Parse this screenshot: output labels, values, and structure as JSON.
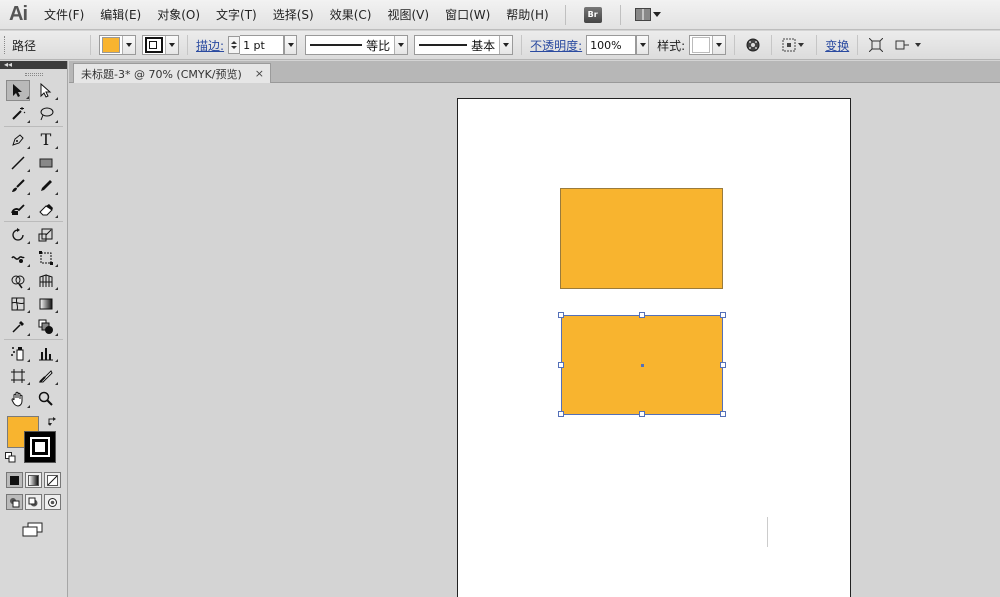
{
  "app": {
    "logo": "Ai"
  },
  "menu": {
    "items": [
      "文件(F)",
      "编辑(E)",
      "对象(O)",
      "文字(T)",
      "选择(S)",
      "效果(C)",
      "视图(V)",
      "窗口(W)",
      "帮助(H)"
    ],
    "bridge_label": "Br"
  },
  "control": {
    "selection_type": "路径",
    "stroke_label": "描边:",
    "stroke_weight": "1 pt",
    "profile_label": "等比",
    "brush_label": "基本",
    "opacity_label": "不透明度:",
    "opacity_value": "100%",
    "style_label": "样式:",
    "transform_label": "变换"
  },
  "document": {
    "tab_title": "未标题-3* @ 70% (CMYK/预览)",
    "close_glyph": "×"
  },
  "colors": {
    "fill": "#f8b42f",
    "stroke": "#000000",
    "accent_link": "#2a4aa0",
    "selection": "#5470b8"
  },
  "icons": {
    "tools": [
      "selection-icon",
      "direct-selection-icon",
      "magic-wand-icon",
      "lasso-icon",
      "pen-icon",
      "type-icon",
      "line-icon",
      "rectangle-icon",
      "paintbrush-icon",
      "pencil-icon",
      "blob-brush-icon",
      "eraser-icon",
      "rotate-icon",
      "scale-icon",
      "warp-icon",
      "free-transform-icon",
      "shape-builder-icon",
      "perspective-grid-icon",
      "mesh-icon",
      "gradient-icon",
      "eyedropper-icon",
      "blend-icon",
      "symbol-sprayer-icon",
      "column-graph-icon",
      "artboard-icon",
      "slice-icon",
      "hand-icon",
      "zoom-icon"
    ]
  },
  "tools_panel": {
    "collapse_glyph": "◂◂",
    "type_glyph": "T"
  }
}
